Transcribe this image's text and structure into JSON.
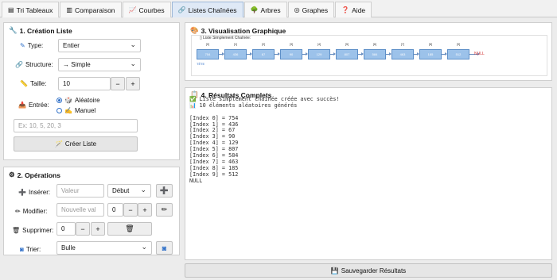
{
  "tabs": [
    {
      "label": "Tri Tableaux",
      "icon": "bar-chart-icon",
      "glyph": "▤"
    },
    {
      "label": "Comparaison",
      "icon": "chart-icon",
      "glyph": "▥"
    },
    {
      "label": "Courbes",
      "icon": "curve-chart-icon",
      "glyph": "📈"
    },
    {
      "label": "Listes Chaînées",
      "icon": "link-icon",
      "glyph": "🔗"
    },
    {
      "label": "Arbres",
      "icon": "tree-icon",
      "glyph": "🌳"
    },
    {
      "label": "Graphes",
      "icon": "graph-icon",
      "glyph": "◎"
    },
    {
      "label": "Aide",
      "icon": "question-icon",
      "glyph": "❓"
    }
  ],
  "creation": {
    "title": "1. Création Liste",
    "type_label": "Type:",
    "type_value": "Entier",
    "structure_label": "Structure:",
    "structure_value": "→ Simple",
    "taille_label": "Taille:",
    "taille_value": "10",
    "minus": "−",
    "plus": "+",
    "entree_label": "Entrée:",
    "option_random": "Aléatoire",
    "option_manual": "Manuel",
    "manual_placeholder": "Ex: 10, 5, 20, 3",
    "create_button": "Créer Liste"
  },
  "operations": {
    "title": "2. Opérations",
    "insert_label": "Insérer:",
    "insert_placeholder": "Valeur",
    "insert_position": "Début",
    "modify_label": "Modifier:",
    "modify_placeholder": "Nouvelle val",
    "modify_index": "0",
    "delete_label": "Supprimer:",
    "delete_index": "0",
    "sort_label": "Trier:",
    "sort_value": "Bulle"
  },
  "visualization": {
    "title": "3. Visualisation Graphique",
    "subtitle": "Liste Simplement Chaînée:",
    "head_label": "TÊTE",
    "null_label": "NULL",
    "nodes": [
      {
        "index": "[0]",
        "value": "754"
      },
      {
        "index": "[1]",
        "value": "436"
      },
      {
        "index": "[2]",
        "value": "67"
      },
      {
        "index": "[3]",
        "value": "90"
      },
      {
        "index": "[4]",
        "value": "129"
      },
      {
        "index": "[5]",
        "value": "807"
      },
      {
        "index": "[6]",
        "value": "584"
      },
      {
        "index": "[7]",
        "value": "463"
      },
      {
        "index": "[8]",
        "value": "185"
      },
      {
        "index": "[9]",
        "value": "512"
      }
    ]
  },
  "results": {
    "title": "4. Résultats Complets",
    "lines": [
      "✅ Liste simplement chaînée créée avec succès!",
      "📊 10 éléments aléatoires générés",
      "",
      "[Index 0] = 754",
      "[Index 1] = 436",
      "[Index 2] = 67",
      "[Index 3] = 90",
      "[Index 4] = 129",
      "[Index 5] = 807",
      "[Index 6] = 584",
      "[Index 7] = 463",
      "[Index 8] = 185",
      "[Index 9] = 512",
      "NULL"
    ]
  },
  "save_button": "Sauvegarder Résultats",
  "colors": {
    "accent": "#3070c8",
    "node_fill": "#9cc2ea",
    "null_text": "#d03030",
    "active_tab": "#dfe9f6"
  }
}
